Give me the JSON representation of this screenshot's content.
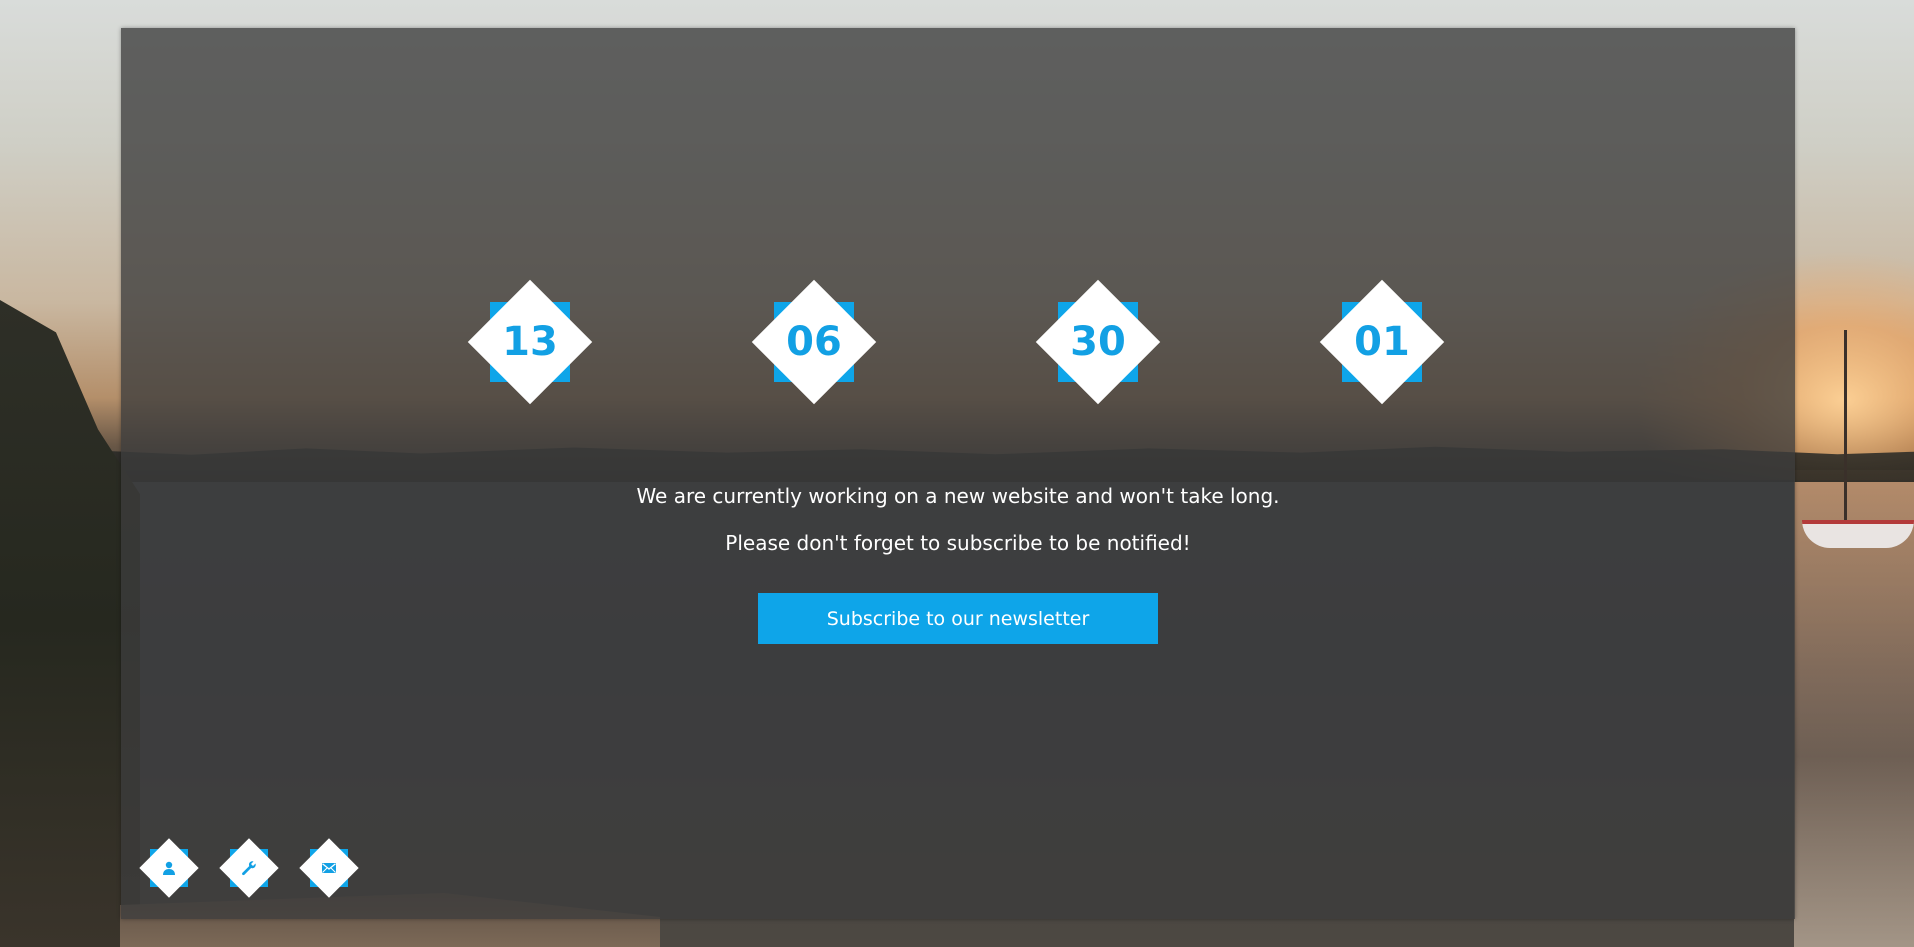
{
  "colors": {
    "accent": "#0ea5e9",
    "number_text": "#12a0e4",
    "overlay": "#3c3c3c",
    "text": "#ffffff"
  },
  "countdown": [
    {
      "value": "13"
    },
    {
      "value": "06"
    },
    {
      "value": "30"
    },
    {
      "value": "01"
    }
  ],
  "message": {
    "line1": "We are currently working on a new website and won't take long.",
    "line2": "Please don't forget to subscribe to be notified!"
  },
  "subscribe": {
    "label": "Subscribe to our newsletter"
  },
  "social": [
    {
      "icon": "user-icon"
    },
    {
      "icon": "wrench-icon"
    },
    {
      "icon": "envelope-icon"
    }
  ]
}
